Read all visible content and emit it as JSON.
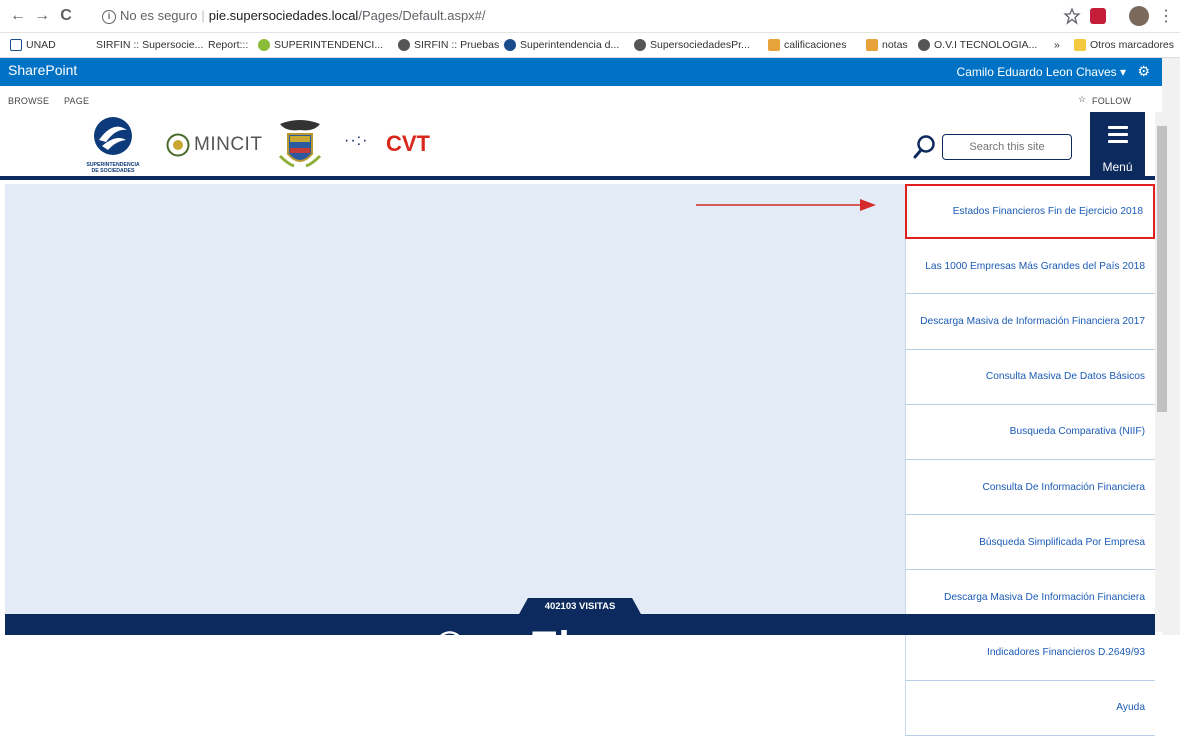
{
  "browser": {
    "back": "←",
    "forward": "→",
    "reload": "C",
    "security_label": "No es seguro",
    "url_domain": "pie.supersociedades.local",
    "url_path": "/Pages/Default.aspx#/",
    "bookmarks": [
      "UNAD",
      "SIRFIN :: Supersocie...",
      "Report:::",
      "SUPERINTENDENCI...",
      "SIRFIN :: Pruebas",
      "Superintendencia d...",
      "SupersociedadesPr...",
      "calificaciones",
      "notas",
      "O.V.I TECNOLOGIA...",
      "»",
      "Otros marcadores"
    ]
  },
  "suitebar": {
    "brand": "SharePoint",
    "user": "Camilo Eduardo Leon Chaves ▾",
    "accent": "#0072c6"
  },
  "ribbon": {
    "browse": "BROWSE",
    "page": "PAGE",
    "follow": "FOLLOW"
  },
  "header": {
    "logo1_line1": "SUPERINTENDENCIA",
    "logo1_line2": "DE SOCIEDADES",
    "logo2": "MINCIT",
    "logo3": "CVT",
    "search_placeholder": "Search this site",
    "menu_label": "Menú",
    "navy": "#0d2a5e"
  },
  "menu": {
    "items": [
      "Estados Financieros Fin de Ejercicio 2018",
      "Las 1000 Empresas Más Grandes del País 2018",
      "Descarga Masiva de Información Financiera 2017",
      "Consulta Masiva De Datos Básicos",
      "Busqueda Comparativa (NIIF)",
      "Consulta De Información Financiera",
      "Búsqueda Simplificada Por Empresa",
      "Descarga Masiva De Información Financiera",
      "Indicadores Financieros D.2649/93",
      "Ayuda"
    ],
    "highlight_color": "#e01f1f"
  },
  "footer": {
    "visits": "402103 VISITAS",
    "big_text": "© ... Th"
  }
}
